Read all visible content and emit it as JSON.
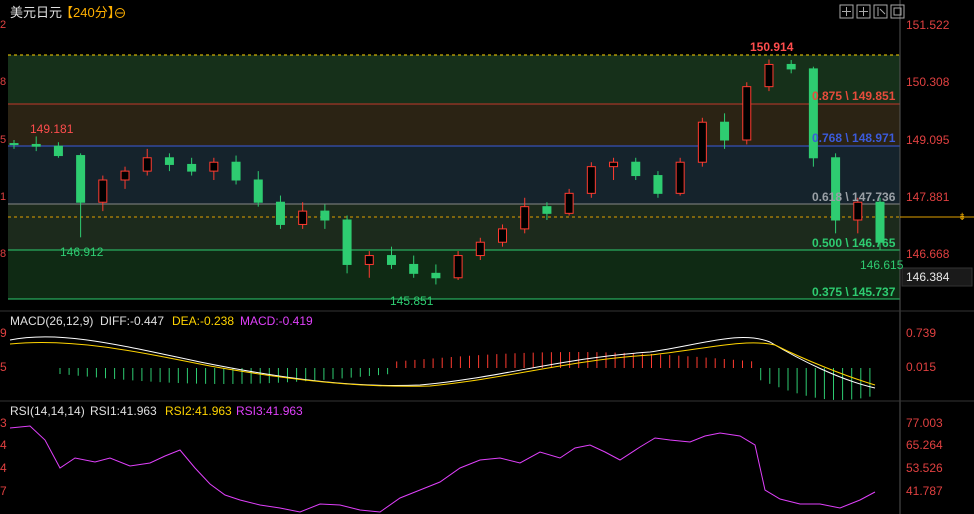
{
  "header": {
    "symbol": "美元日元",
    "period": "【240分】",
    "icon": "target-icon",
    "toolbar_icons": [
      "crosshair-icon",
      "split-icon",
      "single-pane-icon",
      "expand-icon"
    ]
  },
  "price_axis": [
    "151.522",
    "150.308",
    "149.095",
    "147.881",
    "146.668"
  ],
  "current_price": "146.384",
  "left_edge_labels": [
    "2",
    "8",
    "5",
    "1",
    "8"
  ],
  "annotations": {
    "high": "150.914",
    "low": "145.851",
    "left_high": "149.181",
    "left_low": "146.912",
    "right_low": "146.615"
  },
  "fib_levels": [
    {
      "label": "0.875 \\ 149.851",
      "color": "#e74c3c"
    },
    {
      "label": "0.768 \\ 148.971",
      "color": "#3b5bdb"
    },
    {
      "label": "0.618 \\ 147.736",
      "color": "#9aa0a6"
    },
    {
      "label": "0.500 \\ 146.765",
      "color": "#2ecc71"
    },
    {
      "label": "0.375 \\ 145.737",
      "color": "#2ecc71"
    }
  ],
  "macd": {
    "title": "MACD(26,12,9)",
    "diff": "DIFF:-0.447",
    "dea": "DEA:-0.238",
    "macd": "MACD:-0.419",
    "axis": [
      "0.739",
      "0.015"
    ],
    "left_edge": [
      "9",
      "5"
    ]
  },
  "rsi": {
    "title": "RSI(14,14,14)",
    "rsi1": "RSI1:41.963",
    "rsi2": "RSI2:41.963",
    "rsi3": "RSI3:41.963",
    "axis": [
      "77.003",
      "65.264",
      "53.526",
      "41.787"
    ],
    "left_edge": [
      "3",
      "4",
      "4",
      "7"
    ]
  },
  "colors": {
    "up": "#ff3b30",
    "down": "#2ecc71",
    "diff_line": "#ffffff",
    "dea_line": "#ffd400",
    "rsi_line": "#e040fb"
  },
  "chart_data": {
    "type": "candlestick",
    "price_range": [
      145.5,
      151.8
    ],
    "candles": [
      [
        149.02,
        149.1,
        148.9,
        149.0
      ],
      [
        149.0,
        149.18,
        148.85,
        148.96
      ],
      [
        148.96,
        149.05,
        148.7,
        148.75
      ],
      [
        148.75,
        148.8,
        146.91,
        147.7
      ],
      [
        147.7,
        148.3,
        147.5,
        148.2
      ],
      [
        148.2,
        148.5,
        148.0,
        148.4
      ],
      [
        148.4,
        148.9,
        148.3,
        148.7
      ],
      [
        148.7,
        148.8,
        148.4,
        148.55
      ],
      [
        148.55,
        148.7,
        148.3,
        148.4
      ],
      [
        148.4,
        148.7,
        148.2,
        148.6
      ],
      [
        148.6,
        148.75,
        148.1,
        148.2
      ],
      [
        148.2,
        148.4,
        147.6,
        147.7
      ],
      [
        147.7,
        147.85,
        147.1,
        147.2
      ],
      [
        147.2,
        147.7,
        147.1,
        147.5
      ],
      [
        147.5,
        147.65,
        147.1,
        147.3
      ],
      [
        147.3,
        147.4,
        146.1,
        146.3
      ],
      [
        146.3,
        146.6,
        146.0,
        146.5
      ],
      [
        146.5,
        146.7,
        146.2,
        146.3
      ],
      [
        146.3,
        146.5,
        146.0,
        146.1
      ],
      [
        146.1,
        146.3,
        145.85,
        146.0
      ],
      [
        146.0,
        146.6,
        145.95,
        146.5
      ],
      [
        146.5,
        146.9,
        146.4,
        146.8
      ],
      [
        146.8,
        147.2,
        146.7,
        147.1
      ],
      [
        147.1,
        147.8,
        147.0,
        147.6
      ],
      [
        147.6,
        147.7,
        147.3,
        147.45
      ],
      [
        147.45,
        148.0,
        147.4,
        147.9
      ],
      [
        147.9,
        148.6,
        147.8,
        148.5
      ],
      [
        148.5,
        148.7,
        148.2,
        148.6
      ],
      [
        148.6,
        148.7,
        148.2,
        148.3
      ],
      [
        148.3,
        148.4,
        147.8,
        147.9
      ],
      [
        147.9,
        148.7,
        147.85,
        148.6
      ],
      [
        148.6,
        149.6,
        148.5,
        149.5
      ],
      [
        149.5,
        149.7,
        148.9,
        149.1
      ],
      [
        149.1,
        150.4,
        149.0,
        150.3
      ],
      [
        150.3,
        150.91,
        150.2,
        150.8
      ],
      [
        150.8,
        150.9,
        150.6,
        150.7
      ],
      [
        150.7,
        150.75,
        148.5,
        148.7
      ],
      [
        148.7,
        148.8,
        147.0,
        147.3
      ],
      [
        147.3,
        147.8,
        147.0,
        147.7
      ],
      [
        147.7,
        147.8,
        146.62,
        146.8
      ]
    ]
  }
}
